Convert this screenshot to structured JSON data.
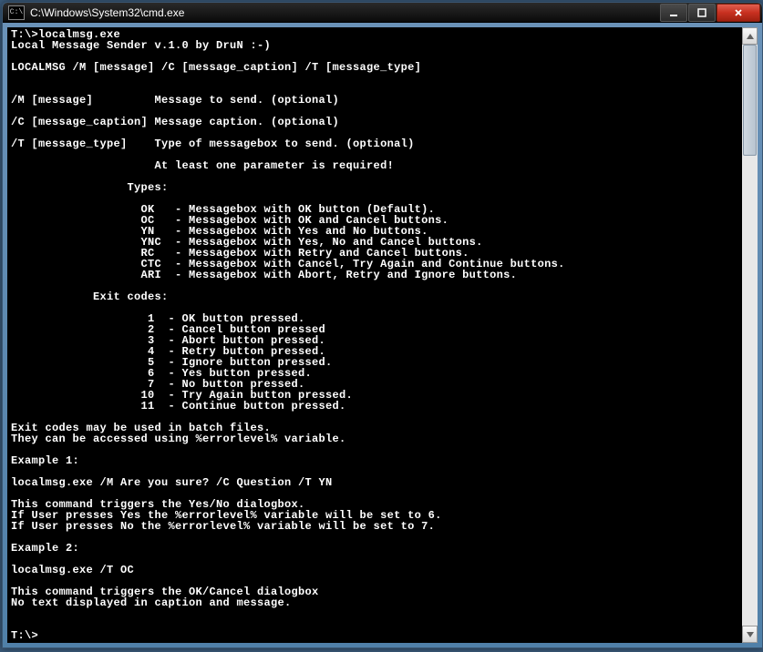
{
  "window": {
    "title": "C:\\Windows\\System32\\cmd.exe",
    "icon_glyph": "C:\\"
  },
  "lines": [
    "T:\\>localmsg.exe",
    "Local Message Sender v.1.0 by DruN :-)",
    "",
    "LOCALMSG /M [message] /C [message_caption] /T [message_type]",
    "",
    "",
    "/M [message]         Message to send. (optional)",
    "",
    "/C [message_caption] Message caption. (optional)",
    "",
    "/T [message_type]    Type of messagebox to send. (optional)",
    "",
    "                     At least one parameter is required!",
    "",
    "                 Types:",
    "",
    "                   OK   - Messagebox with OK button (Default).",
    "                   OC   - Messagebox with OK and Cancel buttons.",
    "                   YN   - Messagebox with Yes and No buttons.",
    "                   YNC  - Messagebox with Yes, No and Cancel buttons.",
    "                   RC   - Messagebox with Retry and Cancel buttons.",
    "                   CTC  - Messagebox with Cancel, Try Again and Continue buttons.",
    "                   ARI  - Messagebox with Abort, Retry and Ignore buttons.",
    "",
    "            Exit codes:",
    "",
    "                    1  - OK button pressed.",
    "                    2  - Cancel button pressed",
    "                    3  - Abort button pressed.",
    "                    4  - Retry button pressed.",
    "                    5  - Ignore button pressed.",
    "                    6  - Yes button pressed.",
    "                    7  - No button pressed.",
    "                   10  - Try Again button pressed.",
    "                   11  - Continue button pressed.",
    "",
    "Exit codes may be used in batch files.",
    "They can be accessed using %errorlevel% variable.",
    "",
    "Example 1:",
    "",
    "localmsg.exe /M Are you sure? /C Question /T YN",
    "",
    "This command triggers the Yes/No dialogbox.",
    "If User presses Yes the %errorlevel% variable will be set to 6.",
    "If User presses No the %errorlevel% variable will be set to 7.",
    "",
    "Example 2:",
    "",
    "localmsg.exe /T OC",
    "",
    "This command triggers the OK/Cancel dialogbox",
    "No text displayed in caption and message.",
    "",
    "",
    "T:\\>"
  ]
}
